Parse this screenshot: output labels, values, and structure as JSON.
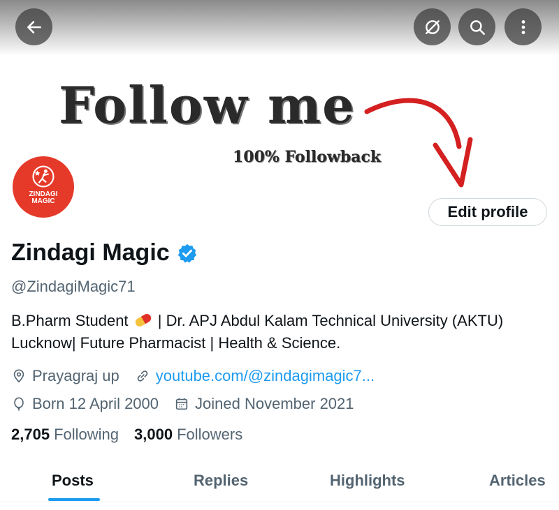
{
  "banner": {
    "title": "Follow me",
    "subtitle": "100% Followback"
  },
  "topbar": {
    "back_icon": "back-arrow-icon",
    "grok_icon": "slashed-circle-icon",
    "search_icon": "search-icon",
    "more_icon": "more-vertical-icon"
  },
  "profile": {
    "avatar_text": "ZINDAGI MAGIC",
    "edit_label": "Edit profile",
    "name": "Zindagi Magic",
    "handle": "@ZindagiMagic71",
    "bio_part1": "B.Pharm Student",
    "bio_part2": "| Dr. APJ Abdul Kalam Technical University (AKTU)",
    "bio_line2": "Lucknow| Future Pharmacist | Health & Science.",
    "location": "Prayagraj up",
    "website": "youtube.com/@zindagimagic7...",
    "birthday": "Born 12 April 2000",
    "joined": "Joined November 2021",
    "following_count": "2,705",
    "following_label": "Following",
    "followers_count": "3,000",
    "followers_label": "Followers"
  },
  "tabs": [
    {
      "label": "Posts",
      "active": true
    },
    {
      "label": "Replies",
      "active": false
    },
    {
      "label": "Highlights",
      "active": false
    },
    {
      "label": "Articles",
      "active": false
    }
  ],
  "colors": {
    "accent": "#1d9bf0",
    "avatar_bg": "#e53a2a",
    "arrow": "#d42020"
  }
}
